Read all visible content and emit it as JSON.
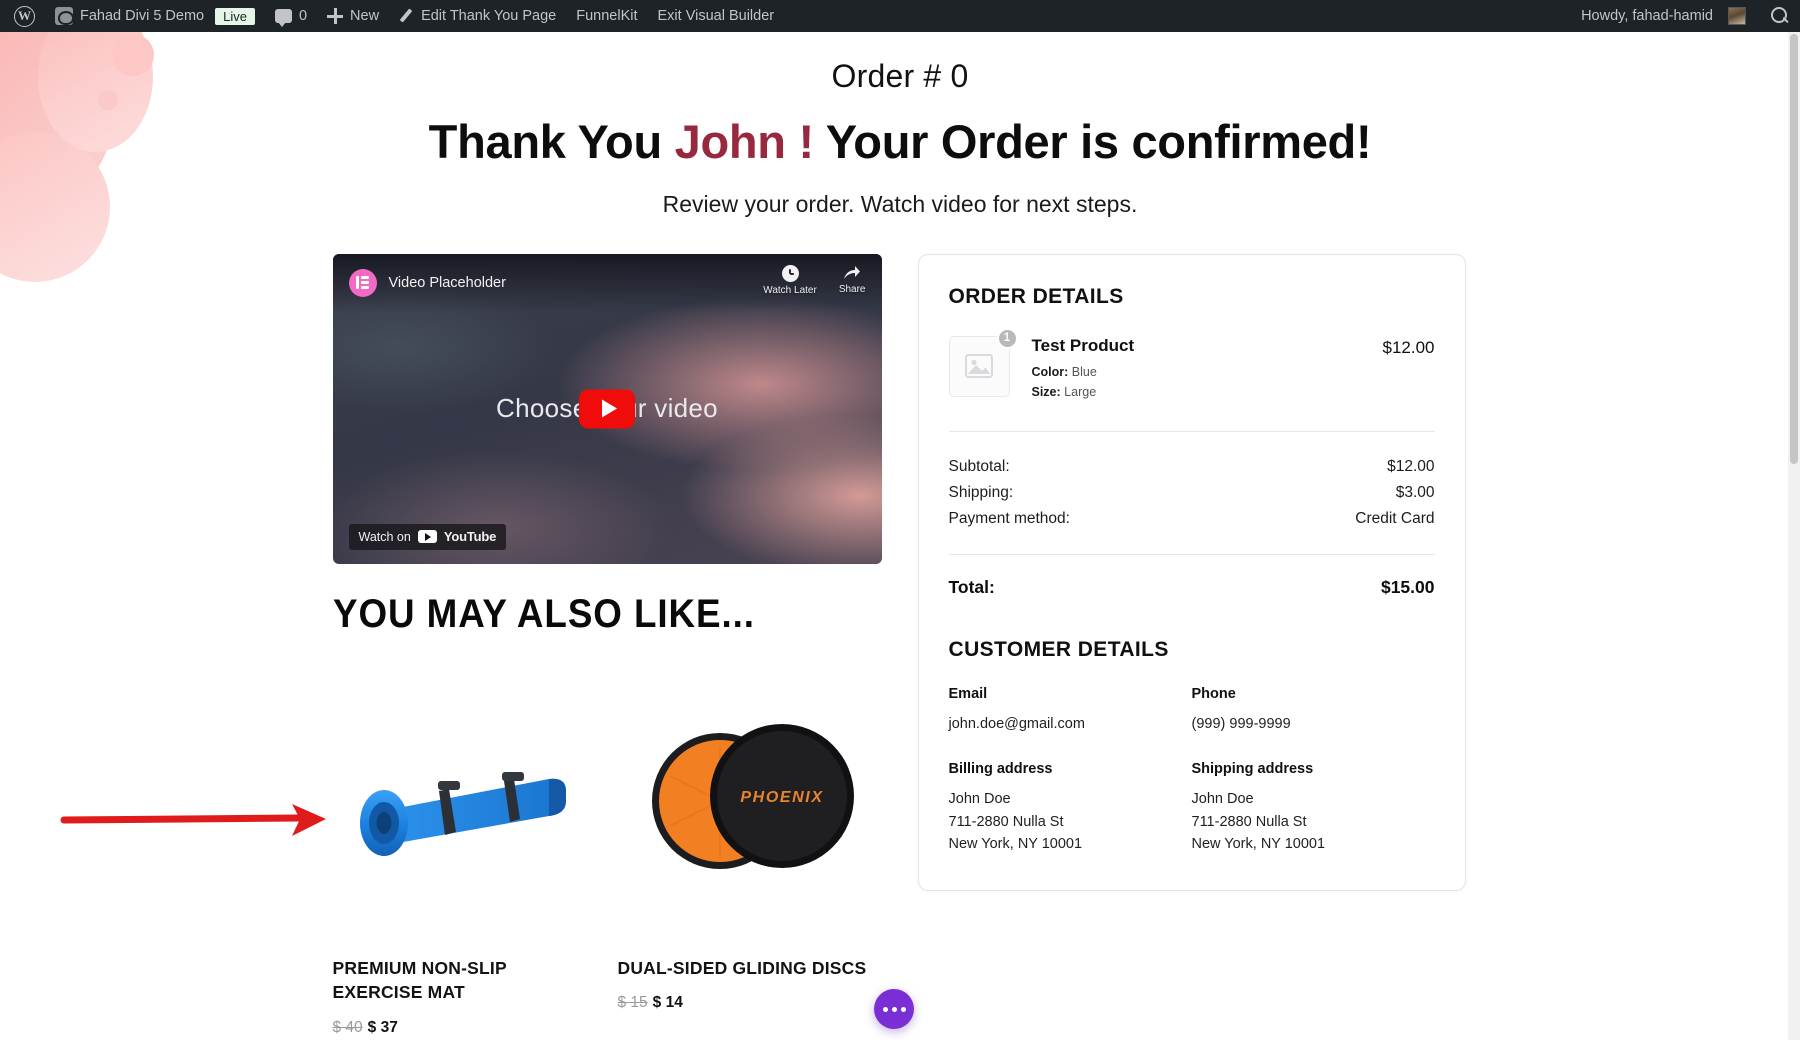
{
  "admin_bar": {
    "logo_icon": "wordpress-logo-icon",
    "site_name": "Fahad Divi 5 Demo",
    "live_badge": "Live",
    "comment_count": "0",
    "new_label": "New",
    "edit_label": "Edit Thank You Page",
    "funnelkit_label": "FunnelKit",
    "exit_label": "Exit Visual Builder",
    "howdy": "Howdy, fahad-hamid",
    "search_icon": "search-icon"
  },
  "hero": {
    "order_number": "Order # 0",
    "thankyou_prefix": "Thank You ",
    "customer_name": "John !",
    "thankyou_suffix": " Your Order is confirmed!",
    "subheading": "Review your order. Watch video for next steps.",
    "name_color": "#97283e"
  },
  "video": {
    "provider_icon": "elementor-icon",
    "title": "Video Placeholder",
    "watch_later_label": "Watch Later",
    "watch_later_icon": "clock-icon",
    "share_label": "Share",
    "share_icon": "share-arrow-icon",
    "center_text": "Choose your video",
    "play_icon": "youtube-play-icon",
    "watch_on_label": "Watch on",
    "watch_on_brand": "YouTube"
  },
  "upsell": {
    "heading": "YOU MAY ALSO LIKE...",
    "products": [
      {
        "name": "PREMIUM NON-SLIP EXERCISE MAT",
        "old_price": "$ 40",
        "new_price": "$ 37",
        "image": "blue-exercise-mat"
      },
      {
        "name": "DUAL-SIDED GLIDING DISCS",
        "old_price": "$ 15",
        "new_price": "$ 14",
        "image": "orange-black-gliding-discs",
        "image_brand": "PHOENIX"
      }
    ]
  },
  "order_card": {
    "order_details_heading": "ORDER DETAILS",
    "item": {
      "qty": "1",
      "thumb_icon": "image-placeholder-icon",
      "name": "Test Product",
      "price": "$12.00",
      "attributes": [
        {
          "label": "Color:",
          "value": "Blue"
        },
        {
          "label": "Size:",
          "value": "Large"
        }
      ]
    },
    "totals": [
      {
        "label": "Subtotal:",
        "value": "$12.00"
      },
      {
        "label": "Shipping:",
        "value": "$3.00"
      },
      {
        "label": "Payment method:",
        "value": "Credit Card"
      }
    ],
    "grand_total_label": "Total:",
    "grand_total_value": "$15.00",
    "customer_details_heading": "CUSTOMER DETAILS",
    "email_label": "Email",
    "email_value": "john.doe@gmail.com",
    "phone_label": "Phone",
    "phone_value": "(999) 999-9999",
    "billing_label": "Billing address",
    "billing_value": "John Doe\n711-2880 Nulla St\nNew York, NY 10001",
    "shipping_label": "Shipping address",
    "shipping_value": "John Doe\n711-2880 Nulla St\nNew York, NY 10001"
  },
  "fab": {
    "icon": "elementor-dots-icon",
    "color": "#7a2fd4"
  },
  "annotation": {
    "arrow_icon": "red-arrow-right-icon",
    "color": "#e01b1b"
  }
}
